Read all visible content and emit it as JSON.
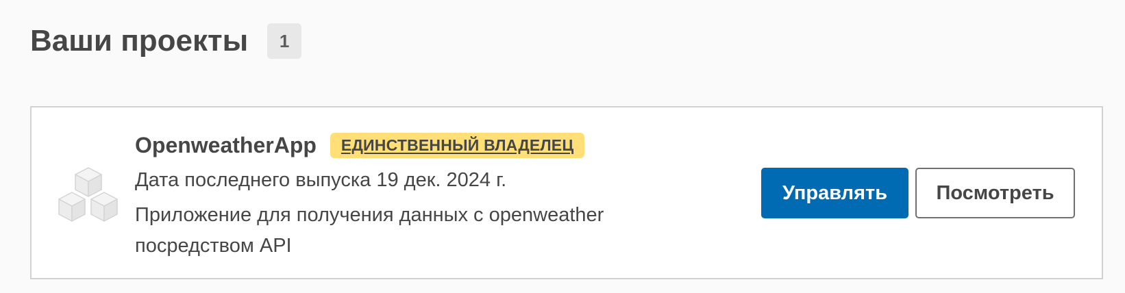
{
  "section": {
    "title": "Ваши проекты",
    "count": "1"
  },
  "project": {
    "icon": "cubes-icon",
    "name": "OpenweatherApp",
    "owner_badge": "ЕДИНСТВЕННЫЙ ВЛАДЕЛЕЦ",
    "release_date": "Дата последнего выпуска 19 дек. 2024 г.",
    "description": "Приложение для получения данных с openweather посредством API",
    "manage_label": "Управлять",
    "view_label": "Посмотреть"
  },
  "colors": {
    "primary_button": "#006bb3",
    "owner_badge_bg": "#ffdf76",
    "count_badge_bg": "#e8e8e8",
    "page_bg": "#fafafa"
  }
}
